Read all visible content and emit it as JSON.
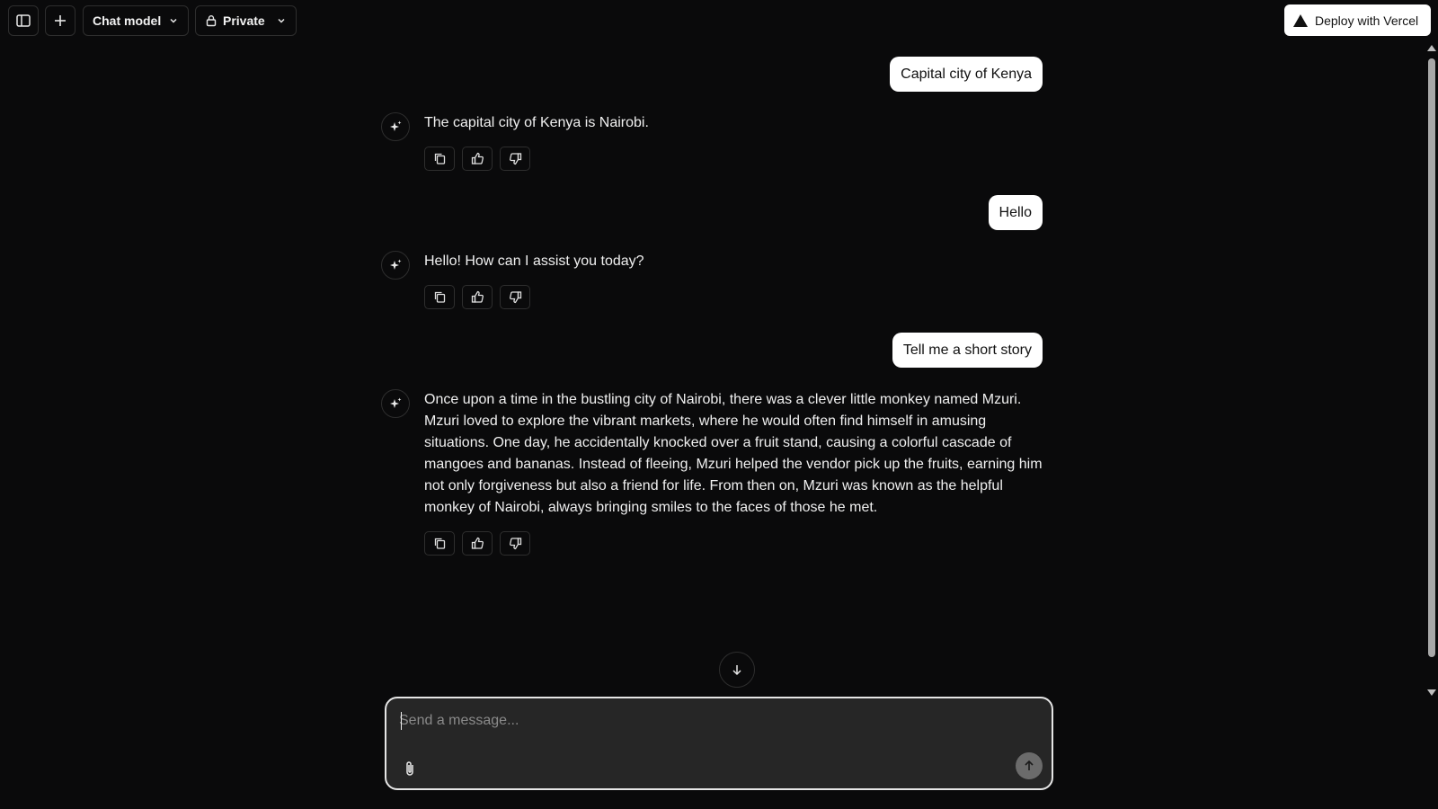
{
  "header": {
    "sidebar_toggle_icon": "sidebar-icon",
    "new_chat_icon": "plus-icon",
    "model_selector": {
      "label": "Chat model",
      "icon": "chevron-down-icon"
    },
    "visibility_selector": {
      "label": "Private",
      "icon": "lock-icon"
    },
    "deploy_button": {
      "label": "Deploy with Vercel",
      "icon": "vercel-triangle-icon"
    }
  },
  "messages": [
    {
      "role": "user",
      "text": "Capital city of Kenya"
    },
    {
      "role": "assistant",
      "text": "The capital city of Kenya is Nairobi.",
      "actions": [
        "copy-icon",
        "thumbs-up-icon",
        "thumbs-down-icon"
      ]
    },
    {
      "role": "user",
      "text": "Hello"
    },
    {
      "role": "assistant",
      "text": "Hello! How can I assist you today?",
      "actions": [
        "copy-icon",
        "thumbs-up-icon",
        "thumbs-down-icon"
      ]
    },
    {
      "role": "user",
      "text": "Tell me a short story"
    },
    {
      "role": "assistant",
      "text": "Once upon a time in the bustling city of Nairobi, there was a clever little monkey named Mzuri. Mzuri loved to explore the vibrant markets, where he would often find himself in amusing situations. One day, he accidentally knocked over a fruit stand, causing a colorful cascade of mangoes and bananas. Instead of fleeing, Mzuri helped the vendor pick up the fruits, earning him not only forgiveness but also a friend for life. From then on, Mzuri was known as the helpful monkey of Nairobi, always bringing smiles to the faces of those he met.",
      "actions": [
        "copy-icon",
        "thumbs-up-icon",
        "thumbs-down-icon"
      ]
    }
  ],
  "composer": {
    "placeholder": "Send a message...",
    "value": "",
    "attach_icon": "paperclip-icon",
    "send_icon": "arrow-up-icon"
  },
  "scroll_down_icon": "arrow-down-icon",
  "colors": {
    "background": "#0a0a0b",
    "user_bubble": "#ffffff",
    "composer_bg": "#262626",
    "border": "#2e2e2e"
  }
}
